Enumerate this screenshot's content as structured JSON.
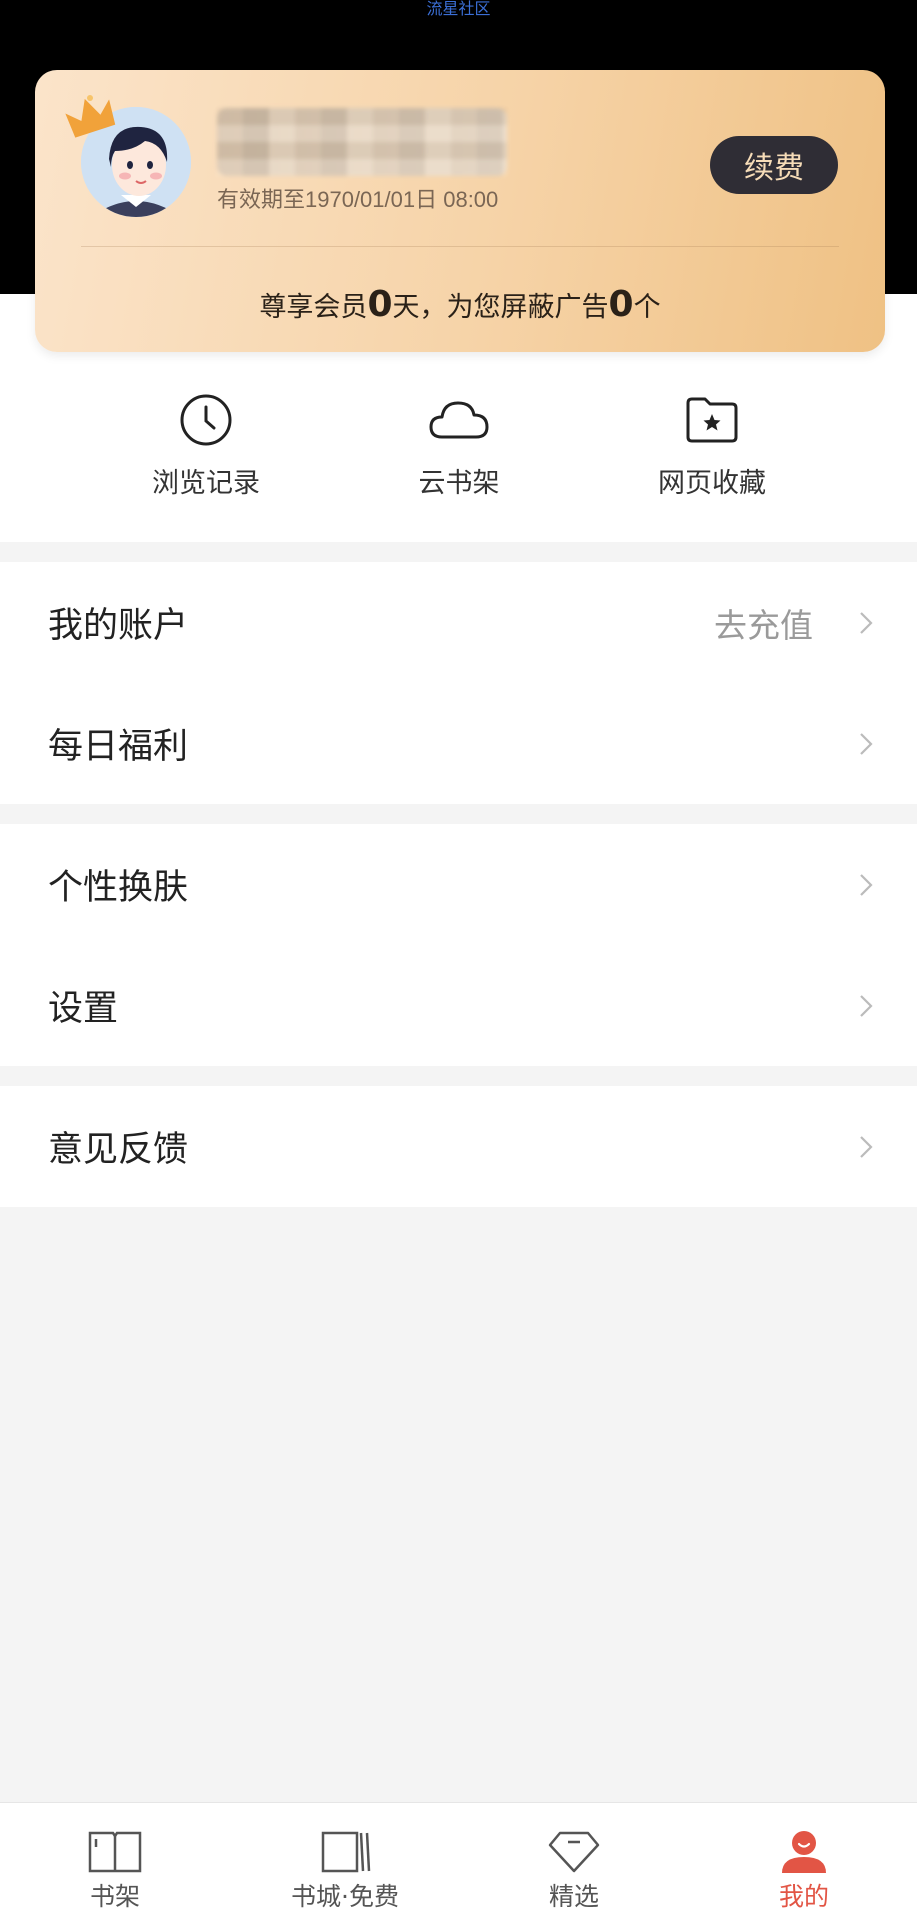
{
  "watermark": "流星社区",
  "vip_card": {
    "expiry": "有效期至1970/01/01日 08:00",
    "renew_label": "续费",
    "stats_prefix": "尊享会员",
    "member_days": "0",
    "stats_middle": "天，为您屏蔽广告",
    "ads_blocked": "0",
    "stats_suffix": "个"
  },
  "quick_actions": [
    {
      "label": "浏览记录",
      "icon": "clock-icon"
    },
    {
      "label": "云书架",
      "icon": "cloud-icon"
    },
    {
      "label": "网页收藏",
      "icon": "star-folder-icon"
    }
  ],
  "menu": {
    "account": {
      "label": "我的账户",
      "action": "去充值"
    },
    "daily_bonus": {
      "label": "每日福利"
    },
    "skin": {
      "label": "个性换肤"
    },
    "settings": {
      "label": "设置"
    },
    "feedback": {
      "label": "意见反馈"
    }
  },
  "tabbar": {
    "items": [
      {
        "label": "书架",
        "icon": "book-icon"
      },
      {
        "label": "书城·免费",
        "icon": "bookstore-icon"
      },
      {
        "label": "精选",
        "icon": "diamond-icon"
      },
      {
        "label": "我的",
        "icon": "profile-icon"
      }
    ],
    "active_index": 3,
    "active_color": "#e25545"
  }
}
